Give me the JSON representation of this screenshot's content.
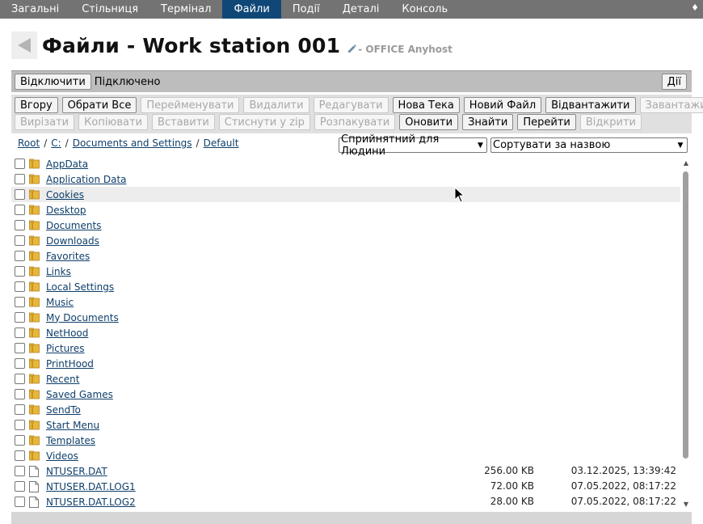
{
  "nav": {
    "tabs": [
      {
        "label": "Загальні",
        "active": false
      },
      {
        "label": "Стільниця",
        "active": false
      },
      {
        "label": "Термінал",
        "active": false
      },
      {
        "label": "Файли",
        "active": true
      },
      {
        "label": "Події",
        "active": false
      },
      {
        "label": "Деталі",
        "active": false
      },
      {
        "label": "Консоль",
        "active": false
      }
    ],
    "corner_glyph": "♦"
  },
  "header": {
    "title": "Файли - Work station 001",
    "group_label": "- OFFICE Anyhost"
  },
  "connection": {
    "disconnect_label": "Відключити",
    "status": "Підключено",
    "actions_label": "Дії"
  },
  "toolbar": {
    "row1": [
      {
        "label": "Вгору",
        "disabled": false
      },
      {
        "label": "Обрати Все",
        "disabled": false
      },
      {
        "label": "Перейменувати",
        "disabled": true
      },
      {
        "label": "Видалити",
        "disabled": true
      },
      {
        "label": "Редагувати",
        "disabled": true
      },
      {
        "label": "Нова Тека",
        "disabled": false
      },
      {
        "label": "Новий Файл",
        "disabled": false
      },
      {
        "label": "Відвантажити",
        "disabled": false
      },
      {
        "label": "Завантажити",
        "disabled": true
      }
    ],
    "row2": [
      {
        "label": "Вирізати",
        "disabled": true
      },
      {
        "label": "Копіювати",
        "disabled": true
      },
      {
        "label": "Вставити",
        "disabled": true
      },
      {
        "label": "Стиснути у zip",
        "disabled": true
      },
      {
        "label": "Розпакувати",
        "disabled": true
      },
      {
        "label": "Оновити",
        "disabled": false
      },
      {
        "label": "Знайти",
        "disabled": false
      },
      {
        "label": "Перейти",
        "disabled": false
      },
      {
        "label": "Відкрити",
        "disabled": true
      }
    ]
  },
  "breadcrumb": {
    "parts": [
      "Root",
      "C:",
      "Documents and Settings",
      "Default"
    ],
    "separator": "/"
  },
  "selects": {
    "size_format": "Сприйнятний для Людини",
    "sort": "Сортувати за назвою"
  },
  "files": [
    {
      "name": "AppData",
      "type": "folder",
      "size": "",
      "date": ""
    },
    {
      "name": "Application Data",
      "type": "folder",
      "size": "",
      "date": ""
    },
    {
      "name": "Cookies",
      "type": "folder",
      "size": "",
      "date": ""
    },
    {
      "name": "Desktop",
      "type": "folder",
      "size": "",
      "date": ""
    },
    {
      "name": "Documents",
      "type": "folder",
      "size": "",
      "date": ""
    },
    {
      "name": "Downloads",
      "type": "folder",
      "size": "",
      "date": ""
    },
    {
      "name": "Favorites",
      "type": "folder",
      "size": "",
      "date": ""
    },
    {
      "name": "Links",
      "type": "folder",
      "size": "",
      "date": ""
    },
    {
      "name": "Local Settings",
      "type": "folder",
      "size": "",
      "date": ""
    },
    {
      "name": "Music",
      "type": "folder",
      "size": "",
      "date": ""
    },
    {
      "name": "My Documents",
      "type": "folder",
      "size": "",
      "date": ""
    },
    {
      "name": "NetHood",
      "type": "folder",
      "size": "",
      "date": ""
    },
    {
      "name": "Pictures",
      "type": "folder",
      "size": "",
      "date": ""
    },
    {
      "name": "PrintHood",
      "type": "folder",
      "size": "",
      "date": ""
    },
    {
      "name": "Recent",
      "type": "folder",
      "size": "",
      "date": ""
    },
    {
      "name": "Saved Games",
      "type": "folder",
      "size": "",
      "date": ""
    },
    {
      "name": "SendTo",
      "type": "folder",
      "size": "",
      "date": ""
    },
    {
      "name": "Start Menu",
      "type": "folder",
      "size": "",
      "date": ""
    },
    {
      "name": "Templates",
      "type": "folder",
      "size": "",
      "date": ""
    },
    {
      "name": "Videos",
      "type": "folder",
      "size": "",
      "date": ""
    },
    {
      "name": "NTUSER.DAT",
      "type": "file",
      "size": "256.00 KB",
      "date": "03.12.2025, 13:39:42"
    },
    {
      "name": "NTUSER.DAT.LOG1",
      "type": "file",
      "size": "72.00 KB",
      "date": "07.05.2022, 08:17:22"
    },
    {
      "name": "NTUSER.DAT.LOG2",
      "type": "file",
      "size": "28.00 KB",
      "date": "07.05.2022, 08:17:22"
    }
  ],
  "hover_row_index": 2,
  "colors": {
    "nav_bg": "#737373",
    "nav_active": "#0f4777",
    "link": "#0f3f6b",
    "folder": "#e8b73a"
  }
}
